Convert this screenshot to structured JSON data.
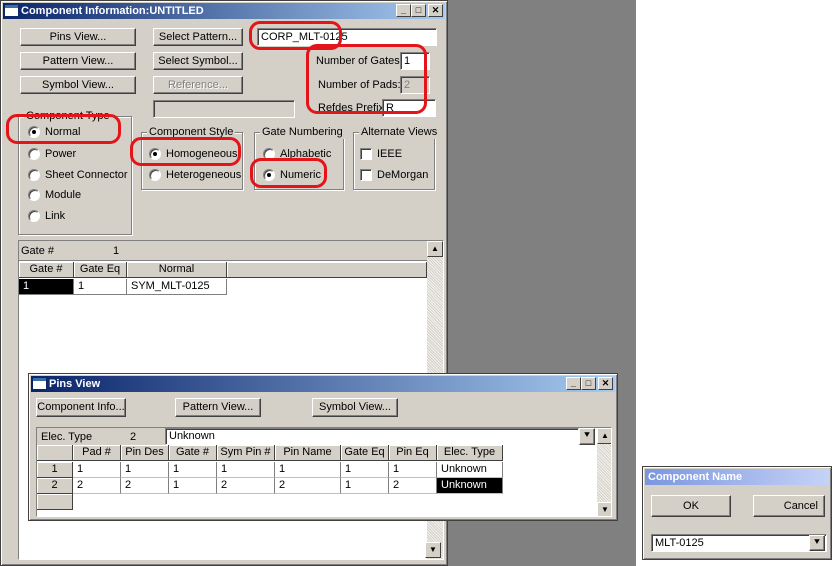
{
  "main_window": {
    "title": "Component Information:UNTITLED",
    "buttons": {
      "pins_view": "Pins View...",
      "pattern_view": "Pattern View...",
      "symbol_view": "Symbol View...",
      "select_pattern": "Select Pattern...",
      "select_symbol": "Select Symbol...",
      "reference": "Reference..."
    },
    "pattern_name_value": "CORP_MLT-0125",
    "number_of_gates_label": "Number of Gates:",
    "number_of_gates_value": "1",
    "number_of_pads_label": "Number of Pads:",
    "number_of_pads_value": "2",
    "refdes_prefix_label": "Refdes Prefix:",
    "refdes_prefix_value": "R",
    "component_type": {
      "title": "Component Type",
      "options": [
        "Normal",
        "Power",
        "Sheet Connector",
        "Module",
        "Link"
      ],
      "selected": "Normal"
    },
    "component_style": {
      "title": "Component Style",
      "options": [
        "Homogeneous",
        "Heterogeneous"
      ],
      "selected": "Homogeneous"
    },
    "gate_numbering": {
      "title": "Gate Numbering",
      "options": [
        "Alphabetic",
        "Numeric"
      ],
      "selected": "Numeric"
    },
    "alternate_views": {
      "title": "Alternate Views",
      "options": [
        "IEEE",
        "DeMorgan"
      ]
    },
    "gate_grid": {
      "edit_label": "Gate #",
      "edit_value": "1",
      "headers": [
        "Gate #",
        "Gate Eq",
        "Normal"
      ],
      "rows": [
        [
          "1",
          "1",
          "SYM_MLT-0125"
        ]
      ]
    }
  },
  "pins_window": {
    "title": "Pins View",
    "buttons": {
      "component_info": "Component Info...",
      "pattern_view": "Pattern View...",
      "symbol_view": "Symbol View..."
    },
    "edit_label": "Elec. Type",
    "edit_row": "2",
    "edit_value": "Unknown",
    "headers": [
      "",
      "Pad #",
      "Pin Des",
      "Gate #",
      "Sym Pin #",
      "Pin Name",
      "Gate Eq",
      "Pin Eq",
      "Elec. Type"
    ],
    "rows": [
      [
        "1",
        "1",
        "1",
        "1",
        "1",
        "1",
        "1",
        "1",
        "Unknown"
      ],
      [
        "2",
        "2",
        "2",
        "1",
        "2",
        "2",
        "1",
        "2",
        "Unknown"
      ]
    ]
  },
  "name_dialog": {
    "title": "Component Name",
    "ok": "OK",
    "cancel": "Cancel",
    "value": "MLT-0125"
  },
  "colors": {
    "highlight_red": "#e3151a",
    "titlebar_active": "#0a246a",
    "titlebar_inactive": "#7a96df",
    "window_face": "#d4d0c8"
  }
}
